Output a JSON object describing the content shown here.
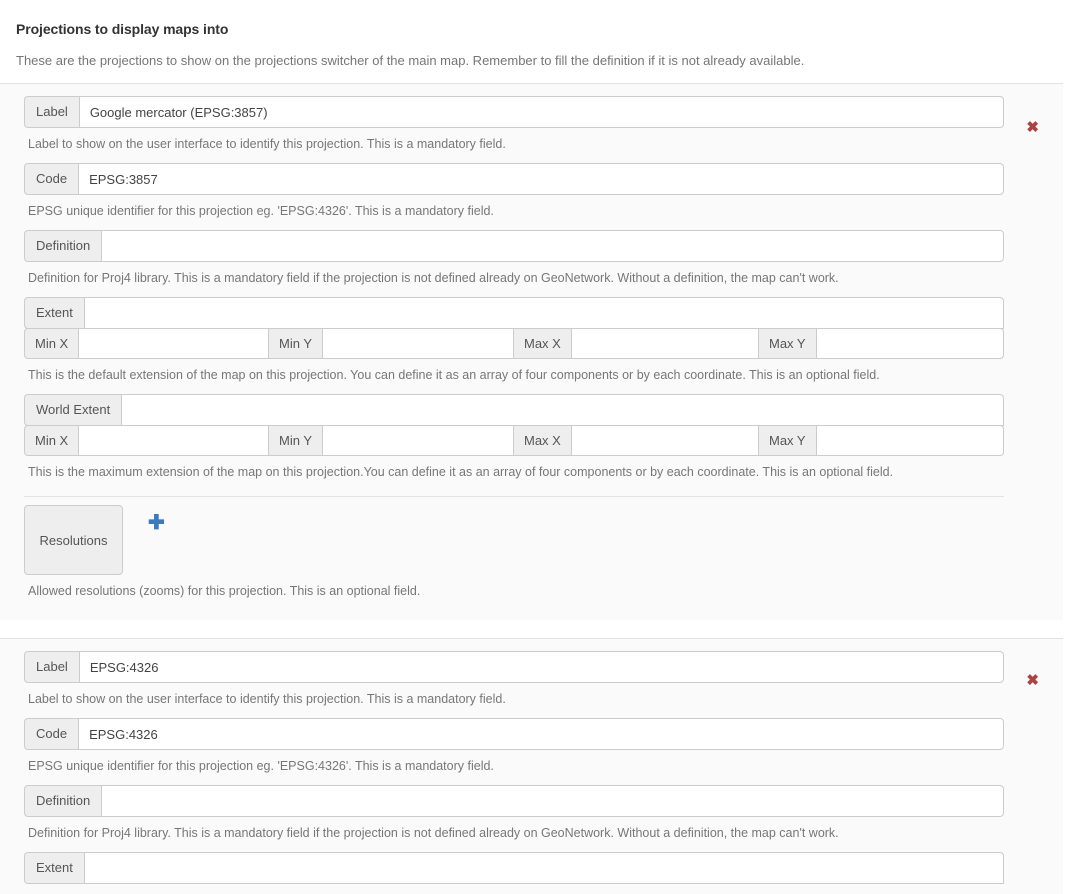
{
  "page": {
    "title": "Projections to display maps into",
    "intro": "These are the projections to show on the projections switcher of the main map. Remember to fill the definition if it is not already available."
  },
  "labels": {
    "label": "Label",
    "code": "Code",
    "definition": "Definition",
    "extent": "Extent",
    "world_extent": "World Extent",
    "resolutions": "Resolutions",
    "min_x": "Min X",
    "min_y": "Min Y",
    "max_x": "Max X",
    "max_y": "Max Y"
  },
  "help": {
    "label": "Label to show on the user interface to identify this projection. This is a mandatory field.",
    "code": "EPSG unique identifier for this projection eg. 'EPSG:4326'. This is a mandatory field.",
    "definition": "Definition for Proj4 library. This is a mandatory field if the projection is not defined already on GeoNetwork. Without a definition, the map can't work.",
    "extent": "This is the default extension of the map on this projection. You can define it as an array of four components or by each coordinate. This is an optional field.",
    "world_extent": "This is the maximum extension of the map on this projection.You can define it as an array of four components or by each coordinate. This is an optional field.",
    "resolutions": "Allowed resolutions (zooms) for this projection. This is an optional field."
  },
  "icons": {
    "delete": "✖",
    "add": "✚"
  },
  "colors": {
    "delete_red": "#a94442",
    "add_blue": "#3a7abd",
    "addon_bg": "#eeeeee",
    "border": "#cccccc",
    "panel_bg": "#fafafa"
  },
  "projections": [
    {
      "label_value": "Google mercator (EPSG:3857)",
      "code_value": "EPSG:3857",
      "definition_value": "",
      "extent_value": "",
      "extent_min_x": "",
      "extent_min_y": "",
      "extent_max_x": "",
      "extent_max_y": "",
      "world_extent_value": "",
      "world_min_x": "",
      "world_min_y": "",
      "world_max_x": "",
      "world_max_y": "",
      "resolutions": []
    },
    {
      "label_value": "EPSG:4326",
      "code_value": "EPSG:4326",
      "definition_value": "",
      "extent_value": "",
      "extent_min_x": "",
      "extent_min_y": "",
      "extent_max_x": "",
      "extent_max_y": "",
      "world_extent_value": "",
      "world_min_x": "",
      "world_min_y": "",
      "world_max_x": "",
      "world_max_y": "",
      "resolutions": []
    }
  ]
}
